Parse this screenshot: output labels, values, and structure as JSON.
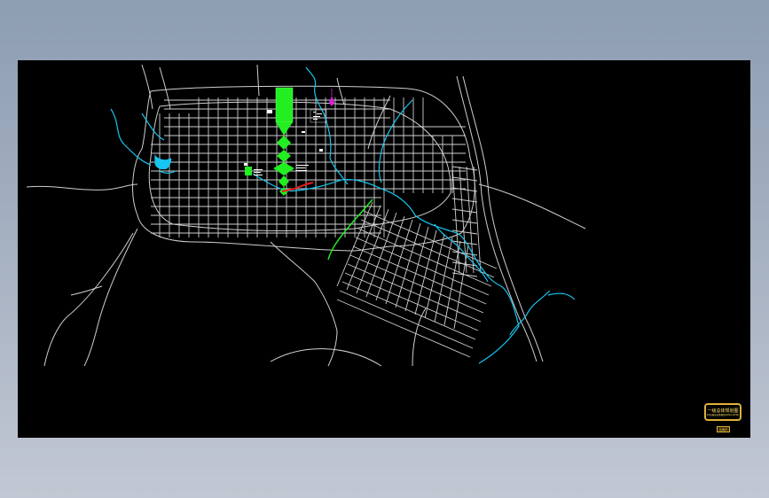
{
  "app": {
    "window_background": "#98a6b9",
    "canvas_background": "#000000"
  },
  "drawing": {
    "layers": {
      "roads": "#d8d8d8",
      "rivers": "#17c6f0",
      "green_axis": "#22ee22",
      "accent_red": "#e11d1d",
      "landmark": "#e020e0",
      "title_frame": "#e0b23a"
    }
  },
  "title_block": {
    "title": "一级总体规划图",
    "subtitle": "XX市城市总体规划(2010-2030)",
    "scale_label": "比例尺"
  }
}
